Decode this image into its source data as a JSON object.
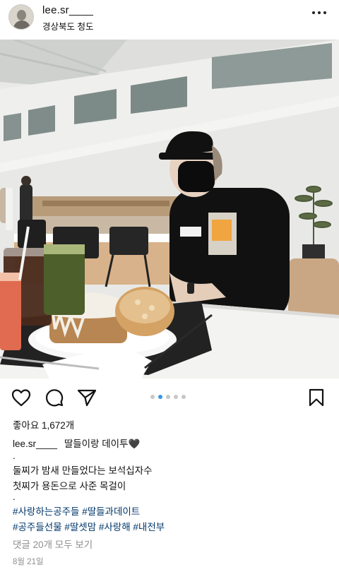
{
  "post": {
    "username": "lee.sr____",
    "location": "경상북도 청도",
    "likes_text": "좋아요 1,672개",
    "caption": {
      "username": "lee.sr____",
      "text": "딸들이랑 데이투🖤",
      "lines": [
        ".",
        "둘찌가 밤새 만들었다는 보석십자수",
        "첫찌가 용돈으로 사준 목걸이",
        "."
      ]
    },
    "hashtags": {
      "line1": "#사랑하는공주들 #딸들과데이트",
      "line2": "#공주들선물 #딸셋맘 #사랑해 #내전부"
    },
    "comments_link": "댓글 20개 모두 보기",
    "date": "8월 21일",
    "carousel": {
      "count": 5,
      "active_index": 1
    }
  },
  "icons": {
    "more": "more-horizontal-icon",
    "like": "heart-icon",
    "comment": "comment-icon",
    "share": "send-icon",
    "save": "bookmark-icon"
  },
  "colors": {
    "accent": "#3897f0",
    "hashtag": "#00376b",
    "muted": "#8e8e8e"
  }
}
